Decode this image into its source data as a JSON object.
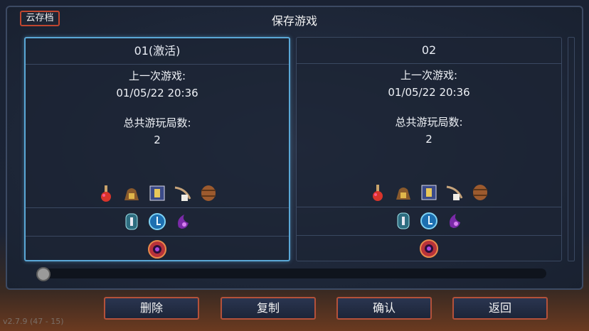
{
  "header": {
    "cloud_label": "云存档",
    "title": "保存游戏"
  },
  "slots": [
    {
      "name": "01(激活)",
      "last_played_label": "上一次游戏:",
      "last_played": "01/05/22  20:36",
      "runs_label": "总共游玩局数:",
      "runs": "2",
      "active": true
    },
    {
      "name": "02",
      "last_played_label": "上一次游戏:",
      "last_played": "01/05/22  20:36",
      "runs_label": "总共游玩局数:",
      "runs": "2",
      "active": false
    }
  ],
  "icons": {
    "row1": [
      "potion-icon",
      "money-bag-icon",
      "book-icon",
      "bow-dice-icon",
      "barrel-icon"
    ],
    "row2": [
      "rune-stone-icon",
      "blue-orb-icon",
      "purple-flame-icon"
    ],
    "row3": [
      "eye-shield-icon"
    ]
  },
  "buttons": {
    "delete": "删除",
    "copy": "复制",
    "confirm": "确认",
    "back": "返回"
  },
  "scroll": {
    "position": 0
  },
  "version": "v2.7.9 (47 - 15)",
  "colors": {
    "accent_border": "#c0462f",
    "active_slot": "#5aa7d6"
  }
}
